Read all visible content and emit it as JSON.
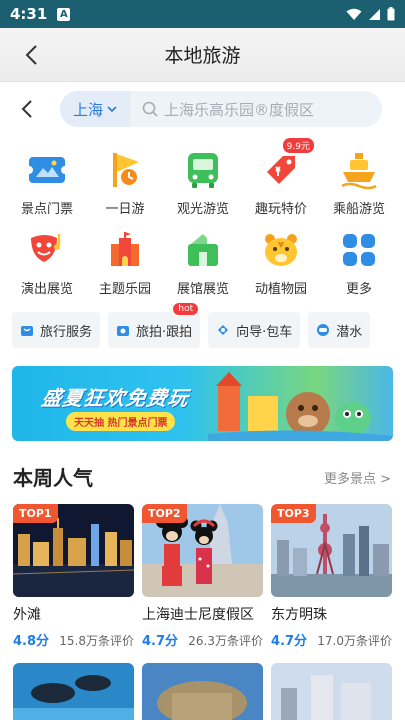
{
  "status_bar": {
    "time": "4:31",
    "notif_badge": "A"
  },
  "header": {
    "title": "本地旅游"
  },
  "search": {
    "city": "上海",
    "placeholder": "上海乐高乐园®度假区"
  },
  "categories": [
    {
      "label": "景点门票",
      "icon": "ticket-icon"
    },
    {
      "label": "一日游",
      "icon": "flag-icon"
    },
    {
      "label": "观光游览",
      "icon": "bus-icon"
    },
    {
      "label": "趣玩特价",
      "icon": "price-tag-icon",
      "badge": "9.9元"
    },
    {
      "label": "乘船游览",
      "icon": "boat-icon"
    },
    {
      "label": "演出展览",
      "icon": "mask-icon"
    },
    {
      "label": "主题乐园",
      "icon": "castle-icon"
    },
    {
      "label": "展馆展览",
      "icon": "museum-icon"
    },
    {
      "label": "动植物园",
      "icon": "tiger-icon"
    },
    {
      "label": "更多",
      "icon": "more-icon"
    }
  ],
  "services": [
    {
      "label": "旅行服务",
      "icon": "bag-icon"
    },
    {
      "label": "旅拍·跟拍",
      "icon": "camera-icon",
      "badge": "hot"
    },
    {
      "label": "向导·包车",
      "icon": "guide-icon"
    },
    {
      "label": "潜水",
      "icon": "dive-icon"
    }
  ],
  "banner": {
    "headline": "盛夏狂欢免费玩",
    "sub": "天天抽 热门景点门票"
  },
  "section": {
    "title": "本周人气",
    "more": "更多景点 >"
  },
  "attractions": [
    {
      "rank": "TOP1",
      "name": "外滩",
      "score": "4.8分",
      "reviews": "15.8万条评价"
    },
    {
      "rank": "TOP2",
      "name": "上海迪士尼度假区",
      "score": "4.7分",
      "reviews": "26.3万条评价"
    },
    {
      "rank": "TOP3",
      "name": "东方明珠",
      "score": "4.7分",
      "reviews": "17.0万条评价"
    }
  ],
  "colors": {
    "status_bar": "#1b5f70",
    "accent": "#2a7be0",
    "rank_badge": "#f0562f"
  }
}
